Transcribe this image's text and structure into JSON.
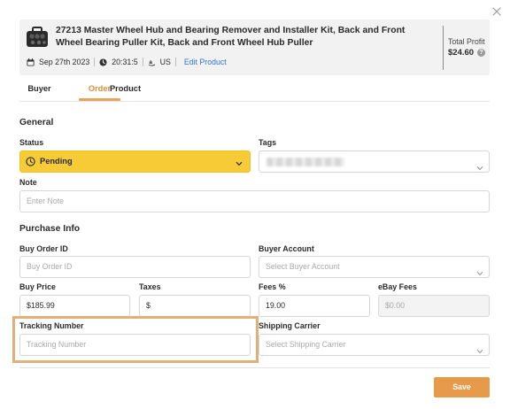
{
  "product": {
    "title": "27213 Master Wheel Hub and Bearing Remover and Installer Kit, Back and Front Wheel Bearing Puller Kit, Back and Front Wheel Hub Puller",
    "date": "Sep 27th 2023",
    "time": "20:31:5",
    "marketplace_icon": "amazon-icon",
    "region": "US",
    "edit_link": "Edit Product",
    "total_profit_label": "Total Profit",
    "total_profit_value": "$24.60"
  },
  "tabs": [
    {
      "label": "Buyer",
      "active": false
    },
    {
      "label": "Order",
      "active": true
    },
    {
      "label": "Product",
      "active": false
    }
  ],
  "general": {
    "title": "General",
    "status_label": "Status",
    "status_value": "Pending",
    "tags_label": "Tags",
    "note_label": "Note",
    "note_placeholder": "Enter Note"
  },
  "purchase": {
    "title": "Purchase Info",
    "buy_order_id_label": "Buy Order ID",
    "buy_order_id_placeholder": "Buy Order ID",
    "buyer_account_label": "Buyer Account",
    "buyer_account_placeholder": "Select Buyer Account",
    "buy_price_label": "Buy Price",
    "buy_price_value": "$185.99",
    "taxes_label": "Taxes",
    "taxes_value": "$",
    "fees_label": "Fees %",
    "fees_value": "19.00",
    "ebay_fees_label": "eBay Fees",
    "ebay_fees_value": "$0.00",
    "tracking_label": "Tracking Number",
    "tracking_placeholder": "Tracking Number",
    "carrier_label": "Shipping Carrier",
    "carrier_placeholder": "Select Shipping Carrier"
  },
  "footer": {
    "save_label": "Save"
  },
  "colors": {
    "accent": "#e79a4a",
    "status_pending": "#f6cb35",
    "highlight": "#deb17a",
    "link": "#2b78d2"
  }
}
